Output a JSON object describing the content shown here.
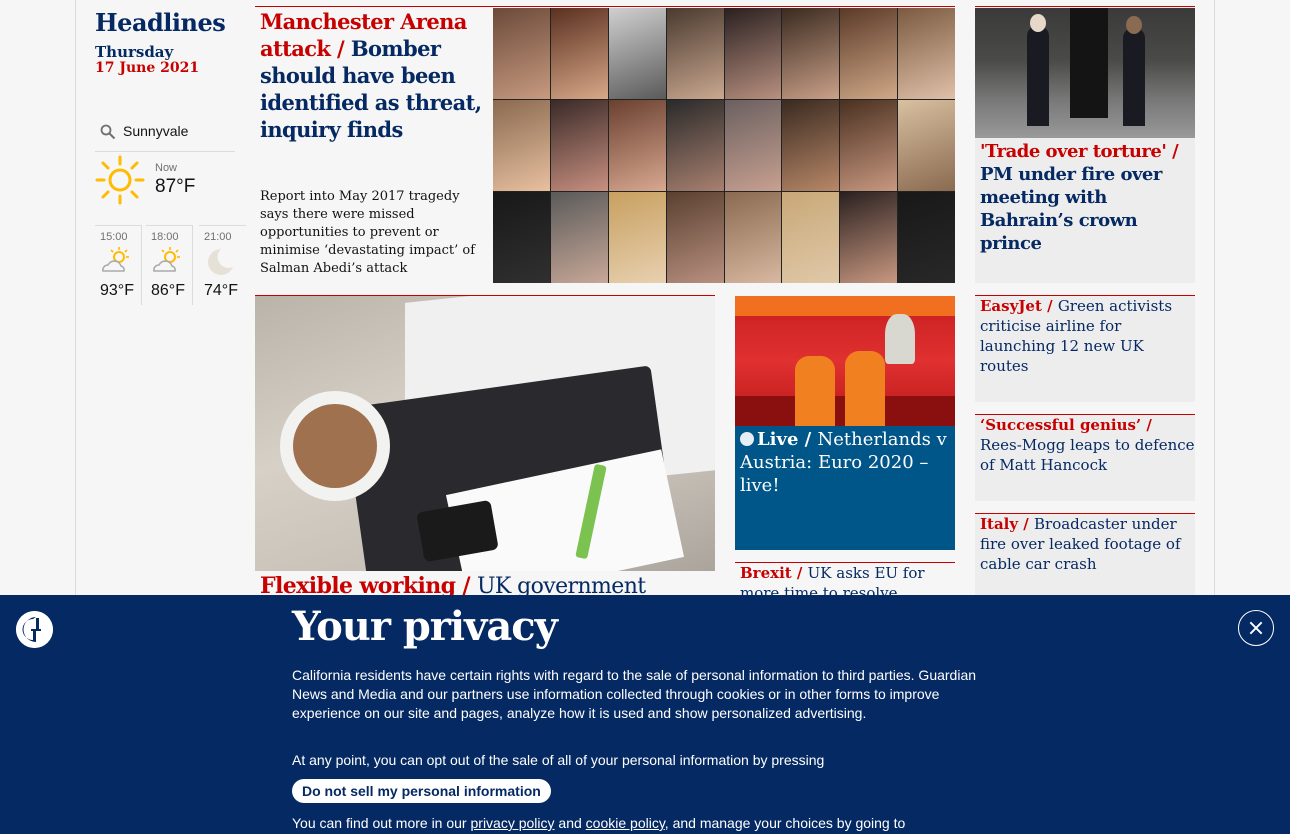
{
  "sidebar": {
    "heading": "Headlines",
    "day": "Thursday",
    "date": "17 June 2021",
    "weather": {
      "location": "Sunnyvale",
      "now_label": "Now",
      "now_temp": "87°F",
      "now_icon": "sun-icon",
      "forecast": [
        {
          "time": "15:00",
          "temp": "93°F",
          "icon": "sun-cloud-icon"
        },
        {
          "time": "18:00",
          "temp": "86°F",
          "icon": "sun-cloud-icon"
        },
        {
          "time": "21:00",
          "temp": "74°F",
          "icon": "moon-icon"
        }
      ]
    }
  },
  "stories": {
    "main": {
      "kicker": "Manchester Arena attack /",
      "headline": "Bomber should have been identified as threat, inquiry finds",
      "standfirst": "Report into May 2017 tragedy says there were missed opportunities to prevent or minimise ‘devastating impact’ of Salman Abedi’s attack"
    },
    "pm": {
      "kicker": "'Trade over torture' /",
      "headline": "PM under fire over meeting with Bahrain’s crown prince"
    },
    "flexible": {
      "kicker": "Flexible working /",
      "headline": "UK government"
    },
    "live": {
      "kicker": "Live /",
      "headline": "Netherlands v Austria: Euro 2020 – live!"
    },
    "brexit": {
      "kicker": "Brexit /",
      "headline": "UK asks EU for more time to resolve"
    },
    "easyjet": {
      "kicker": "EasyJet /",
      "headline": "Green activists criticise airline for launching 12 new UK routes"
    },
    "reesmogg": {
      "kicker": "‘Successful genius’ /",
      "headline": "Rees-Mogg leaps to defence of Matt Hancock"
    },
    "italy": {
      "kicker": "Italy /",
      "headline": "Broadcaster under fire over leaked footage of cable car crash"
    }
  },
  "privacy": {
    "title": "Your privacy",
    "para1": "California residents have certain rights with regard to the sale of personal information to third parties. Guardian News and Media and our partners use information collected through cookies or in other forms to improve experience on our site and pages, analyze how it is used and show personalized advertising.",
    "para2": "At any point, you can opt out of the sale of all of your personal information by pressing",
    "button": "Do not sell my personal information",
    "para3_start": "You can find out more in our",
    "privacy_link": "privacy policy",
    "and": "and",
    "cookie_link": "cookie policy",
    "para3_end": ", and manage your choices by going to"
  },
  "colors": {
    "brand_navy": "#052962",
    "kicker_red": "#c70000",
    "live_blue": "#005689"
  }
}
